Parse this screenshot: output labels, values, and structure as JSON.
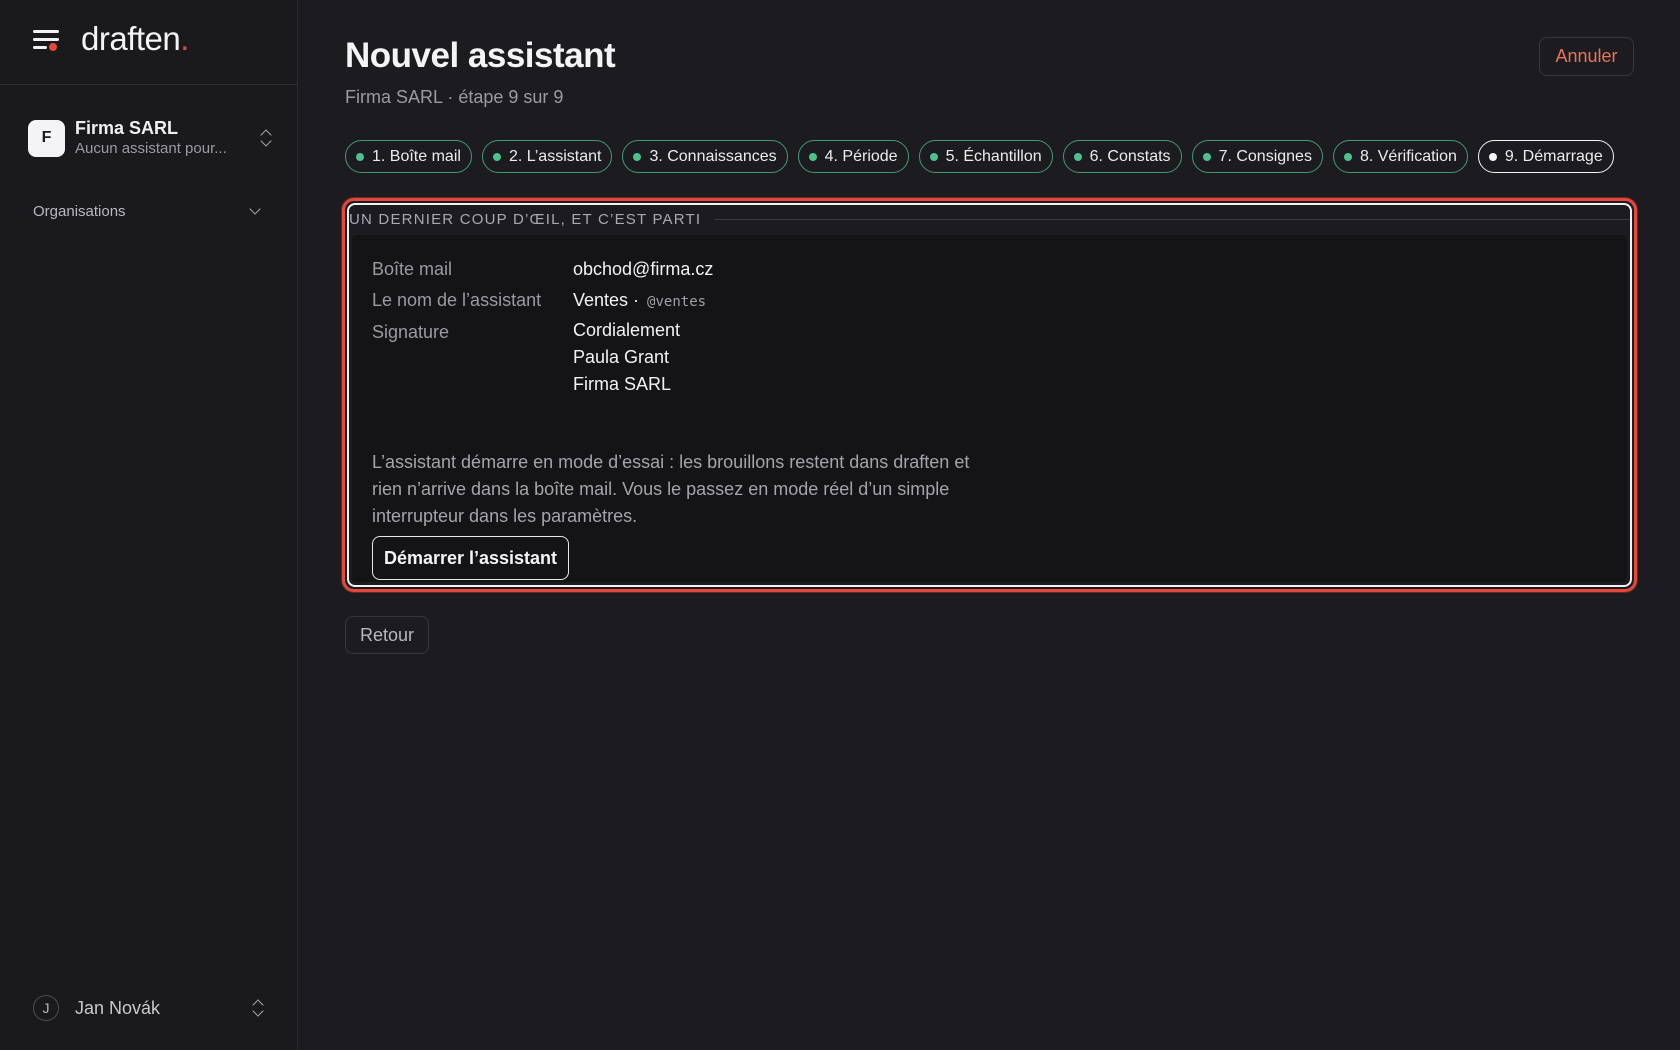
{
  "app": {
    "logo_text": "draften",
    "logo_dot": ".",
    "accent_color": "#e5483a",
    "success_color": "#4cc38a"
  },
  "sidebar": {
    "menu_icon": "hamburger-menu-icon",
    "org": {
      "initial": "F",
      "name": "Firma SARL",
      "subtitle": "Aucun assistant pour..."
    },
    "organisations_label": "Organisations",
    "user": {
      "initial": "J",
      "name": "Jan Novák"
    }
  },
  "header": {
    "title": "Nouvel assistant",
    "subtitle": "Firma SARL · étape 9 sur 9",
    "cancel_label": "Annuler"
  },
  "steps": [
    {
      "label": "1. Boîte mail",
      "status": "done"
    },
    {
      "label": "2. L’assistant",
      "status": "done"
    },
    {
      "label": "3. Connaissances",
      "status": "done"
    },
    {
      "label": "4. Période",
      "status": "done"
    },
    {
      "label": "5. Échantillon",
      "status": "done"
    },
    {
      "label": "6. Constats",
      "status": "done"
    },
    {
      "label": "7. Consignes",
      "status": "done"
    },
    {
      "label": "8. Vérification",
      "status": "done"
    },
    {
      "label": "9. Démarrage",
      "status": "current"
    }
  ],
  "review": {
    "section_title": "UN DERNIER COUP D’ŒIL, ET C’EST PARTI",
    "mailbox_label": "Boîte mail",
    "mailbox_value": "obchod@firma.cz",
    "name_label": "Le nom de l’assistant",
    "name_value": "Ventes ·",
    "handle_value": "@ventes",
    "signature_label": "Signature",
    "signature_lines": [
      "Cordialement",
      "Paula Grant",
      "Firma SARL"
    ],
    "note": "L’assistant démarre en mode d’essai : les brouillons restent dans draften et rien n’arrive dans la boîte mail. Vous le passez en mode réel d’un simple interrupteur dans les paramètres.",
    "start_label": "Démarrer l’assistant"
  },
  "footer": {
    "back_label": "Retour"
  }
}
